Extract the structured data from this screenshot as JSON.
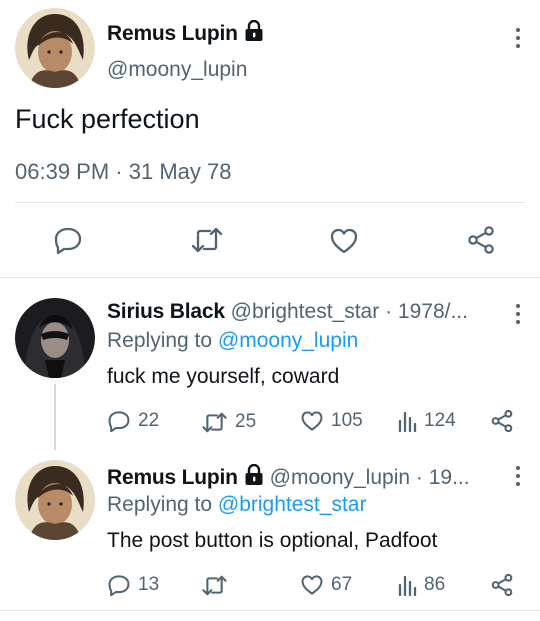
{
  "main_tweet": {
    "author_name": "Remus Lupin",
    "author_handle": "@moony_lupin",
    "text": "Fuck perfection",
    "time": "06:39 PM",
    "separator": "·",
    "date": "31 May 78",
    "icons": [
      "reply-icon",
      "retweet-icon",
      "like-icon",
      "share-icon"
    ]
  },
  "replies": [
    {
      "author_name": "Sirius Black",
      "author_handle": "@brightest_star",
      "timestamp": "· 1978/...",
      "replying_prefix": "Replying to",
      "replying_to": "@moony_lupin",
      "text": "fuck me yourself, coward",
      "counts": {
        "replies": "22",
        "retweets": "25",
        "likes": "105",
        "views": "124"
      }
    },
    {
      "author_name": "Remus Lupin",
      "author_handle": "@moony_lupin",
      "timestamp": "· 19...",
      "replying_prefix": "Replying to",
      "replying_to": "@brightest_star",
      "text": "The post button is optional, Padfoot",
      "counts": {
        "replies": "13",
        "retweets": "",
        "likes": "67",
        "views": "86"
      }
    }
  ],
  "colors": {
    "accent": "#1d9bf0",
    "secondary_text": "#536471",
    "primary_text": "#0f1419",
    "divider": "#dde3e8"
  }
}
